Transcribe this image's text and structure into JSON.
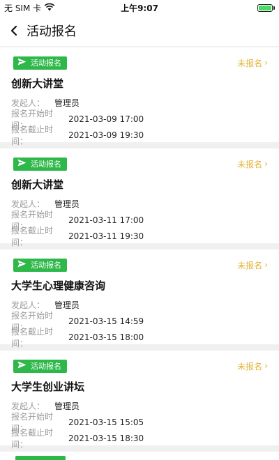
{
  "status_bar": {
    "carrier": "无 SIM 卡",
    "time": "上午9:07",
    "battery_color": "#4cd964"
  },
  "nav": {
    "back_icon": "chevron-left-icon",
    "title": "活动报名"
  },
  "colors": {
    "tag_bg": "#2fb84a",
    "status": "#e0b43a",
    "label": "#9a9a9a"
  },
  "labels": {
    "organizer": "发起人：",
    "start": "报名开始时间：",
    "end": "报名截止时间："
  },
  "events": [
    {
      "tag": "活动报名",
      "status": "未报名",
      "title": "创新大讲堂",
      "organizer": "管理员",
      "start": "2021-03-09 17:00",
      "end": "2021-03-09 19:30"
    },
    {
      "tag": "活动报名",
      "status": "未报名",
      "title": "创新大讲堂",
      "organizer": "管理员",
      "start": "2021-03-11 17:00",
      "end": "2021-03-11 19:30"
    },
    {
      "tag": "活动报名",
      "status": "未报名",
      "title": "大学生心理健康咨询",
      "organizer": "管理员",
      "start": "2021-03-15 14:59",
      "end": "2021-03-15 18:00"
    },
    {
      "tag": "活动报名",
      "status": "未报名",
      "title": "大学生创业讲坛",
      "organizer": "管理员",
      "start": "2021-03-15 15:05",
      "end": "2021-03-15 18:30"
    }
  ]
}
